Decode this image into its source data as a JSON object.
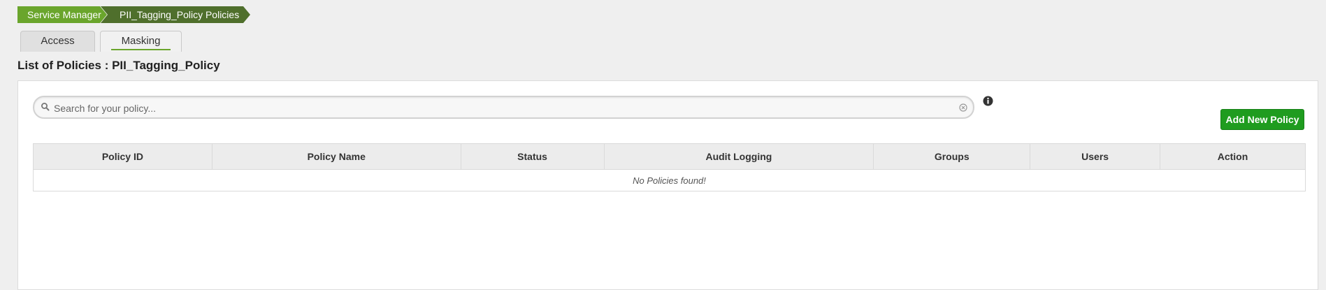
{
  "breadcrumb": {
    "items": [
      "Service Manager",
      "PII_Tagging_Policy Policies"
    ]
  },
  "tabs": [
    {
      "label": "Access",
      "active": false
    },
    {
      "label": "Masking",
      "active": true
    }
  ],
  "page_title": "List of Policies : PII_Tagging_Policy",
  "search": {
    "placeholder": "Search for your policy...",
    "value": ""
  },
  "toolbar": {
    "add_label": "Add New Policy"
  },
  "table": {
    "columns": [
      "Policy ID",
      "Policy Name",
      "Status",
      "Audit Logging",
      "Groups",
      "Users",
      "Action"
    ],
    "empty_message": "No Policies found!"
  },
  "colors": {
    "breadcrumb_primary": "#6aa52c",
    "breadcrumb_secondary": "#4f6f2c",
    "add_button": "#1f9c1f"
  },
  "icons": [
    "search-icon",
    "clear-icon",
    "info-icon"
  ]
}
